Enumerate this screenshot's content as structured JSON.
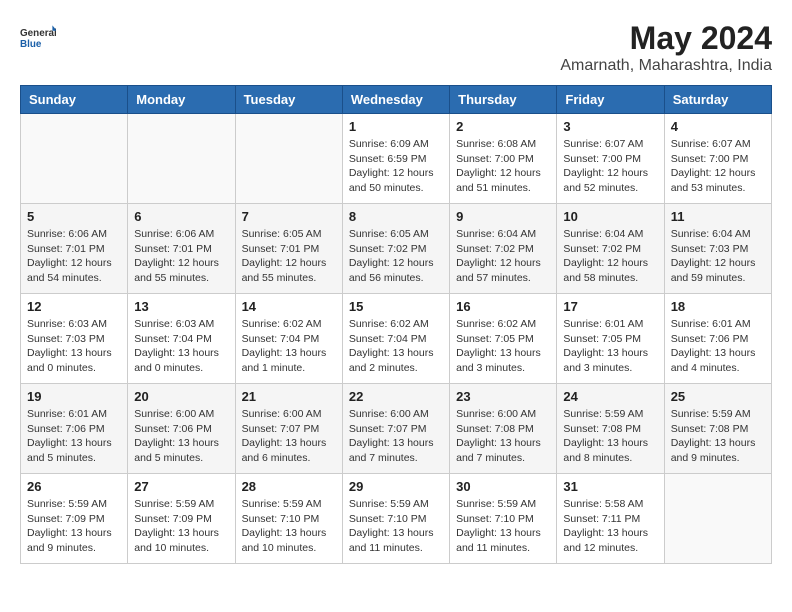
{
  "header": {
    "logo_general": "General",
    "logo_blue": "Blue",
    "month_year": "May 2024",
    "location": "Amarnath, Maharashtra, India"
  },
  "weekdays": [
    "Sunday",
    "Monday",
    "Tuesday",
    "Wednesday",
    "Thursday",
    "Friday",
    "Saturday"
  ],
  "weeks": [
    [
      {
        "day": "",
        "info": []
      },
      {
        "day": "",
        "info": []
      },
      {
        "day": "",
        "info": []
      },
      {
        "day": "1",
        "info": [
          "Sunrise: 6:09 AM",
          "Sunset: 6:59 PM",
          "Daylight: 12 hours",
          "and 50 minutes."
        ]
      },
      {
        "day": "2",
        "info": [
          "Sunrise: 6:08 AM",
          "Sunset: 7:00 PM",
          "Daylight: 12 hours",
          "and 51 minutes."
        ]
      },
      {
        "day": "3",
        "info": [
          "Sunrise: 6:07 AM",
          "Sunset: 7:00 PM",
          "Daylight: 12 hours",
          "and 52 minutes."
        ]
      },
      {
        "day": "4",
        "info": [
          "Sunrise: 6:07 AM",
          "Sunset: 7:00 PM",
          "Daylight: 12 hours",
          "and 53 minutes."
        ]
      }
    ],
    [
      {
        "day": "5",
        "info": [
          "Sunrise: 6:06 AM",
          "Sunset: 7:01 PM",
          "Daylight: 12 hours",
          "and 54 minutes."
        ]
      },
      {
        "day": "6",
        "info": [
          "Sunrise: 6:06 AM",
          "Sunset: 7:01 PM",
          "Daylight: 12 hours",
          "and 55 minutes."
        ]
      },
      {
        "day": "7",
        "info": [
          "Sunrise: 6:05 AM",
          "Sunset: 7:01 PM",
          "Daylight: 12 hours",
          "and 55 minutes."
        ]
      },
      {
        "day": "8",
        "info": [
          "Sunrise: 6:05 AM",
          "Sunset: 7:02 PM",
          "Daylight: 12 hours",
          "and 56 minutes."
        ]
      },
      {
        "day": "9",
        "info": [
          "Sunrise: 6:04 AM",
          "Sunset: 7:02 PM",
          "Daylight: 12 hours",
          "and 57 minutes."
        ]
      },
      {
        "day": "10",
        "info": [
          "Sunrise: 6:04 AM",
          "Sunset: 7:02 PM",
          "Daylight: 12 hours",
          "and 58 minutes."
        ]
      },
      {
        "day": "11",
        "info": [
          "Sunrise: 6:04 AM",
          "Sunset: 7:03 PM",
          "Daylight: 12 hours",
          "and 59 minutes."
        ]
      }
    ],
    [
      {
        "day": "12",
        "info": [
          "Sunrise: 6:03 AM",
          "Sunset: 7:03 PM",
          "Daylight: 13 hours",
          "and 0 minutes."
        ]
      },
      {
        "day": "13",
        "info": [
          "Sunrise: 6:03 AM",
          "Sunset: 7:04 PM",
          "Daylight: 13 hours",
          "and 0 minutes."
        ]
      },
      {
        "day": "14",
        "info": [
          "Sunrise: 6:02 AM",
          "Sunset: 7:04 PM",
          "Daylight: 13 hours",
          "and 1 minute."
        ]
      },
      {
        "day": "15",
        "info": [
          "Sunrise: 6:02 AM",
          "Sunset: 7:04 PM",
          "Daylight: 13 hours",
          "and 2 minutes."
        ]
      },
      {
        "day": "16",
        "info": [
          "Sunrise: 6:02 AM",
          "Sunset: 7:05 PM",
          "Daylight: 13 hours",
          "and 3 minutes."
        ]
      },
      {
        "day": "17",
        "info": [
          "Sunrise: 6:01 AM",
          "Sunset: 7:05 PM",
          "Daylight: 13 hours",
          "and 3 minutes."
        ]
      },
      {
        "day": "18",
        "info": [
          "Sunrise: 6:01 AM",
          "Sunset: 7:06 PM",
          "Daylight: 13 hours",
          "and 4 minutes."
        ]
      }
    ],
    [
      {
        "day": "19",
        "info": [
          "Sunrise: 6:01 AM",
          "Sunset: 7:06 PM",
          "Daylight: 13 hours",
          "and 5 minutes."
        ]
      },
      {
        "day": "20",
        "info": [
          "Sunrise: 6:00 AM",
          "Sunset: 7:06 PM",
          "Daylight: 13 hours",
          "and 5 minutes."
        ]
      },
      {
        "day": "21",
        "info": [
          "Sunrise: 6:00 AM",
          "Sunset: 7:07 PM",
          "Daylight: 13 hours",
          "and 6 minutes."
        ]
      },
      {
        "day": "22",
        "info": [
          "Sunrise: 6:00 AM",
          "Sunset: 7:07 PM",
          "Daylight: 13 hours",
          "and 7 minutes."
        ]
      },
      {
        "day": "23",
        "info": [
          "Sunrise: 6:00 AM",
          "Sunset: 7:08 PM",
          "Daylight: 13 hours",
          "and 7 minutes."
        ]
      },
      {
        "day": "24",
        "info": [
          "Sunrise: 5:59 AM",
          "Sunset: 7:08 PM",
          "Daylight: 13 hours",
          "and 8 minutes."
        ]
      },
      {
        "day": "25",
        "info": [
          "Sunrise: 5:59 AM",
          "Sunset: 7:08 PM",
          "Daylight: 13 hours",
          "and 9 minutes."
        ]
      }
    ],
    [
      {
        "day": "26",
        "info": [
          "Sunrise: 5:59 AM",
          "Sunset: 7:09 PM",
          "Daylight: 13 hours",
          "and 9 minutes."
        ]
      },
      {
        "day": "27",
        "info": [
          "Sunrise: 5:59 AM",
          "Sunset: 7:09 PM",
          "Daylight: 13 hours",
          "and 10 minutes."
        ]
      },
      {
        "day": "28",
        "info": [
          "Sunrise: 5:59 AM",
          "Sunset: 7:10 PM",
          "Daylight: 13 hours",
          "and 10 minutes."
        ]
      },
      {
        "day": "29",
        "info": [
          "Sunrise: 5:59 AM",
          "Sunset: 7:10 PM",
          "Daylight: 13 hours",
          "and 11 minutes."
        ]
      },
      {
        "day": "30",
        "info": [
          "Sunrise: 5:59 AM",
          "Sunset: 7:10 PM",
          "Daylight: 13 hours",
          "and 11 minutes."
        ]
      },
      {
        "day": "31",
        "info": [
          "Sunrise: 5:58 AM",
          "Sunset: 7:11 PM",
          "Daylight: 13 hours",
          "and 12 minutes."
        ]
      },
      {
        "day": "",
        "info": []
      }
    ]
  ]
}
